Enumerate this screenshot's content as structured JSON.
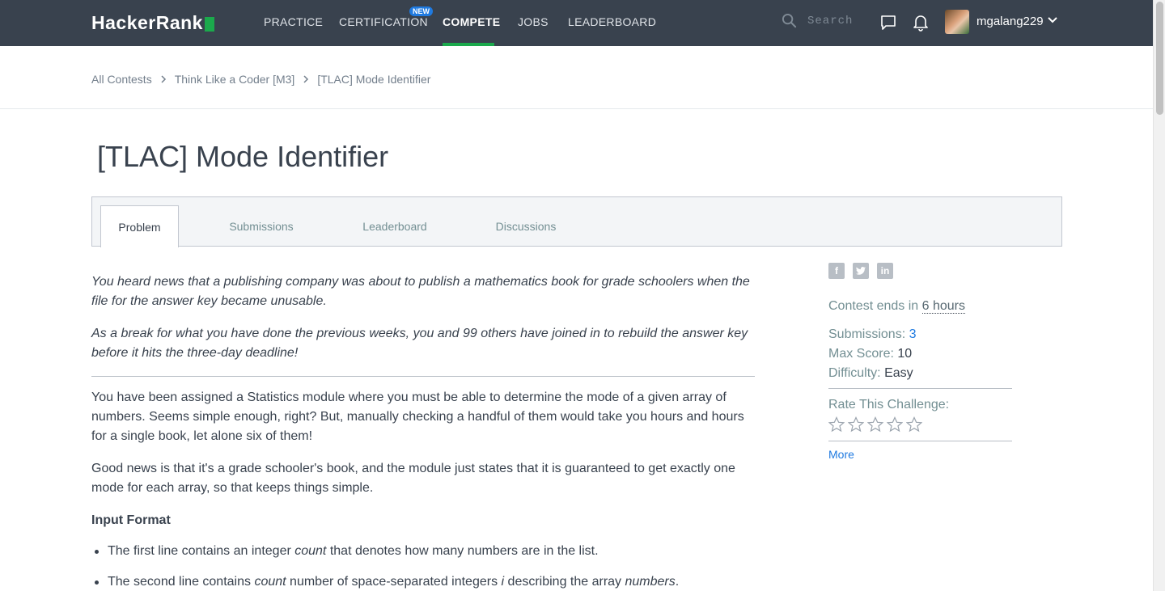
{
  "nav": {
    "logo": "HackerRank",
    "items": [
      "PRACTICE",
      "CERTIFICATION",
      "COMPETE",
      "JOBS",
      "LEADERBOARD"
    ],
    "new_badge": "NEW",
    "search_placeholder": "Search",
    "username": "mgalang229",
    "icons": [
      "search-icon",
      "chat-icon",
      "bell-icon",
      "chevron-down-icon"
    ],
    "accent_color": "#1ba94c"
  },
  "breadcrumb": [
    "All Contests",
    "Think Like a Coder [M3]",
    "[TLAC] Mode Identifier"
  ],
  "title": "[TLAC] Mode Identifier",
  "tabs": [
    "Problem",
    "Submissions",
    "Leaderboard",
    "Discussions"
  ],
  "content": {
    "intro1": "You heard news that a publishing company was about to publish a mathematics book for grade schoolers when the file for the answer key became unusable.",
    "intro2": "As a break for what you have done the previous weeks, you and 99 others have joined in to rebuild the answer key before it hits the three-day deadline!",
    "para1": "You have been assigned a Statistics module where you must be able to determine the mode of a given array of numbers. Seems simple enough, right? But, manually checking a handful of them would take you hours and hours for a single book, let alone six of them!",
    "para2": "Good news is that it's a grade schooler's book, and the module just states that it is guaranteed to get exactly one mode for each array, so that keeps things simple.",
    "input_heading": "Input Format",
    "bullet1": {
      "pre": "The first line contains an integer ",
      "em": "count",
      "post": " that denotes how many numbers are in the list."
    },
    "bullet2": {
      "pre": "The second line contains ",
      "em1": "count",
      "mid": " number of space-separated integers ",
      "em2": "i",
      "mid2": " describing the array ",
      "em3": "numbers",
      "post": "."
    }
  },
  "sidebar": {
    "share_icons": [
      "facebook-icon",
      "twitter-icon",
      "linkedin-icon"
    ],
    "contest_ends_label": "Contest ends in",
    "contest_ends_value": "6 hours",
    "submissions_label": "Submissions:",
    "submissions_value": "3",
    "max_score_label": "Max Score:",
    "max_score_value": "10",
    "difficulty_label": "Difficulty:",
    "difficulty_value": "Easy",
    "rate_label": "Rate This Challenge:",
    "more": "More"
  }
}
